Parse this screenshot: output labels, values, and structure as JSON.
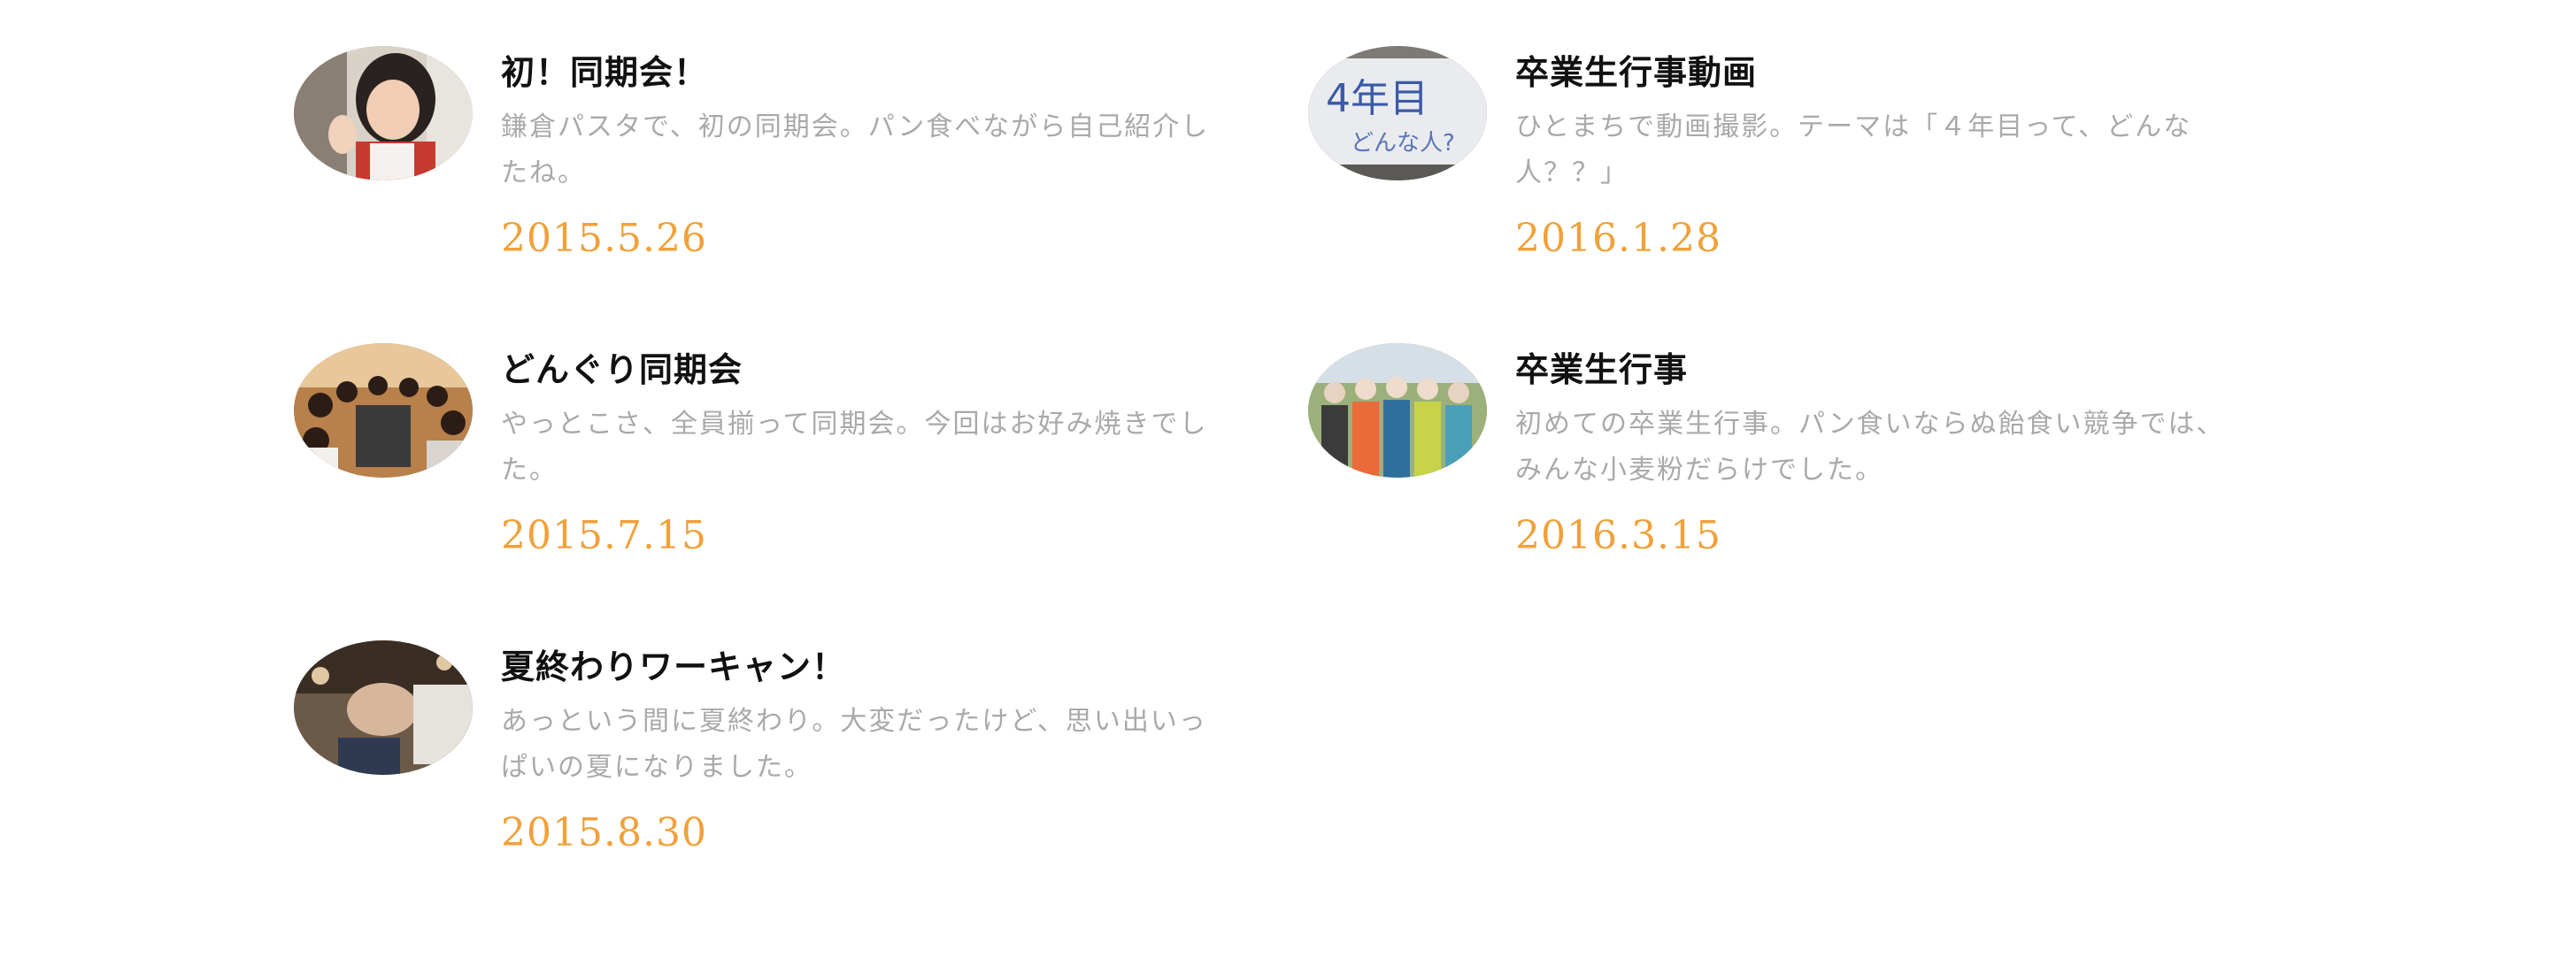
{
  "entries": [
    {
      "title": "初！同期会！",
      "description": "鎌倉パスタで、初の同期会。パン食べながら自己紹介したね。",
      "date": "2015.5.26"
    },
    {
      "title": "どんぐり同期会",
      "description": "やっとこさ、全員揃って同期会。今回はお好み焼きでした。",
      "date": "2015.7.15"
    },
    {
      "title": "夏終わりワーキャン！",
      "description": "あっという間に夏終わり。大変だったけど、思い出いっぱいの夏になりました。",
      "date": "2015.8.30"
    },
    {
      "title": "卒業生行事動画",
      "description": "ひとまちで動画撮影。テーマは「４年目って、どんな人？？」",
      "date": "2016.1.28",
      "thumbnail_text": "4年目\nどんな人?"
    },
    {
      "title": "卒業生行事",
      "description": "初めての卒業生行事。パン食いならぬ飴食い競争では、みんな小麦粉だらけでした。",
      "date": "2016.3.15"
    }
  ],
  "colors": {
    "title": "#111111",
    "description": "#a9a9a9",
    "date": "#f0a13a"
  }
}
